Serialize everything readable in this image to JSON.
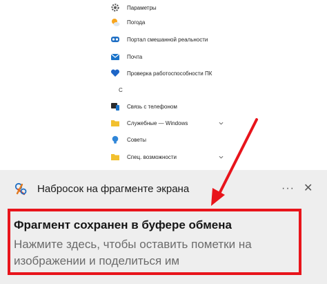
{
  "start_menu": {
    "items": [
      {
        "label": "Параметры",
        "icon": "settings-gear-icon"
      },
      {
        "label": "Погода",
        "icon": "weather-sun-icon"
      },
      {
        "label": "Портал смешанной реальности",
        "icon": "mixed-reality-icon"
      },
      {
        "label": "Почта",
        "icon": "mail-icon"
      },
      {
        "label": "Проверка работоспособности ПК",
        "icon": "pc-health-icon"
      },
      {
        "label": "Связь с телефоном",
        "icon": "phone-link-icon"
      },
      {
        "label": "Служебные — Windows",
        "icon": "folder-icon"
      },
      {
        "label": "Советы",
        "icon": "tips-icon"
      },
      {
        "label": "Спец. возможности",
        "icon": "folder-icon"
      }
    ],
    "letter_header": "С"
  },
  "notification": {
    "app_name": "Набросок на фрагменте экрана",
    "more_label": "···",
    "close_label": "✕",
    "title": "Фрагмент сохранен в буфере обмена",
    "body": "Нажмите здесь, чтобы оставить пометки на изображении и поделиться им"
  },
  "colors": {
    "highlight_border": "#e8141b",
    "arrow": "#e8141b",
    "notification_bg": "#eeeeee"
  }
}
